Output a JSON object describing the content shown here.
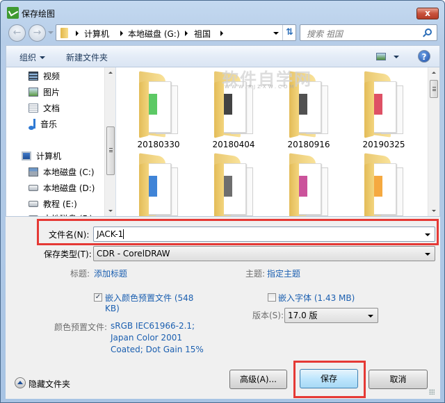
{
  "window": {
    "title": "保存绘图",
    "close_label": "x"
  },
  "navigation": {
    "breadcrumbs": [
      "计算机",
      "本地磁盘 (G:)",
      "祖国"
    ],
    "search_placeholder": "搜索 祖国"
  },
  "toolbar": {
    "organize_label": "组织",
    "new_folder_label": "新建文件夹",
    "help_label": "?"
  },
  "sidebar": {
    "items": [
      {
        "label": "视频",
        "icon": "video-icon"
      },
      {
        "label": "图片",
        "icon": "pictures-icon"
      },
      {
        "label": "文档",
        "icon": "documents-icon"
      },
      {
        "label": "音乐",
        "icon": "music-icon"
      },
      {
        "label": "计算机",
        "icon": "computer-icon"
      },
      {
        "label": "本地磁盘 (C:)",
        "icon": "system-drive-icon"
      },
      {
        "label": "本地磁盘 (D:)",
        "icon": "drive-icon"
      },
      {
        "label": "教程 (E:)",
        "icon": "drive-icon"
      },
      {
        "label": "本地磁盘 (F:)",
        "icon": "drive-icon"
      }
    ]
  },
  "files": {
    "folders": [
      {
        "name": "20180330",
        "accent": "#3fbf4a"
      },
      {
        "name": "20180404",
        "accent": "#222222"
      },
      {
        "name": "20180916",
        "accent": "#333333"
      },
      {
        "name": "20190325",
        "accent": "#d8324a"
      },
      {
        "name": "",
        "accent": "#1e6fd0"
      },
      {
        "name": "",
        "accent": "#555555"
      },
      {
        "name": "",
        "accent": "#c2358a"
      },
      {
        "name": "",
        "accent": "#f39a1e"
      }
    ],
    "watermark": "软件自学网",
    "watermark_sub": "WWW.RJZXW.COM"
  },
  "form": {
    "filename_label": "文件名(N):",
    "filename_value": "JACK-1",
    "filetype_label": "保存类型(T):",
    "filetype_value": "CDR - CorelDRAW",
    "title_label": "标题:",
    "title_link": "添加标题",
    "subject_label": "主题:",
    "subject_link": "指定主题",
    "embed_color_label": "嵌入颜色预置文件 (548",
    "embed_color_label_2": "KB)",
    "embed_color_checked": true,
    "embed_font_label": "嵌入字体 (1.43 MB)",
    "embed_font_checked": false,
    "version_label": "版本(S):",
    "version_value": "17.0 版",
    "color_profile_label": "颜色预置文件:",
    "color_profile_lines": [
      "sRGB IEC61966-2.1;",
      "Japan Color 2001",
      "Coated; Dot Gain 15%"
    ]
  },
  "footer": {
    "hide_folders_label": "隐藏文件夹",
    "advanced_label": "高级(A)...",
    "save_label": "保存",
    "cancel_label": "取消"
  },
  "colors": {
    "highlight_box": "#e53935",
    "link": "#1b5fb0"
  }
}
